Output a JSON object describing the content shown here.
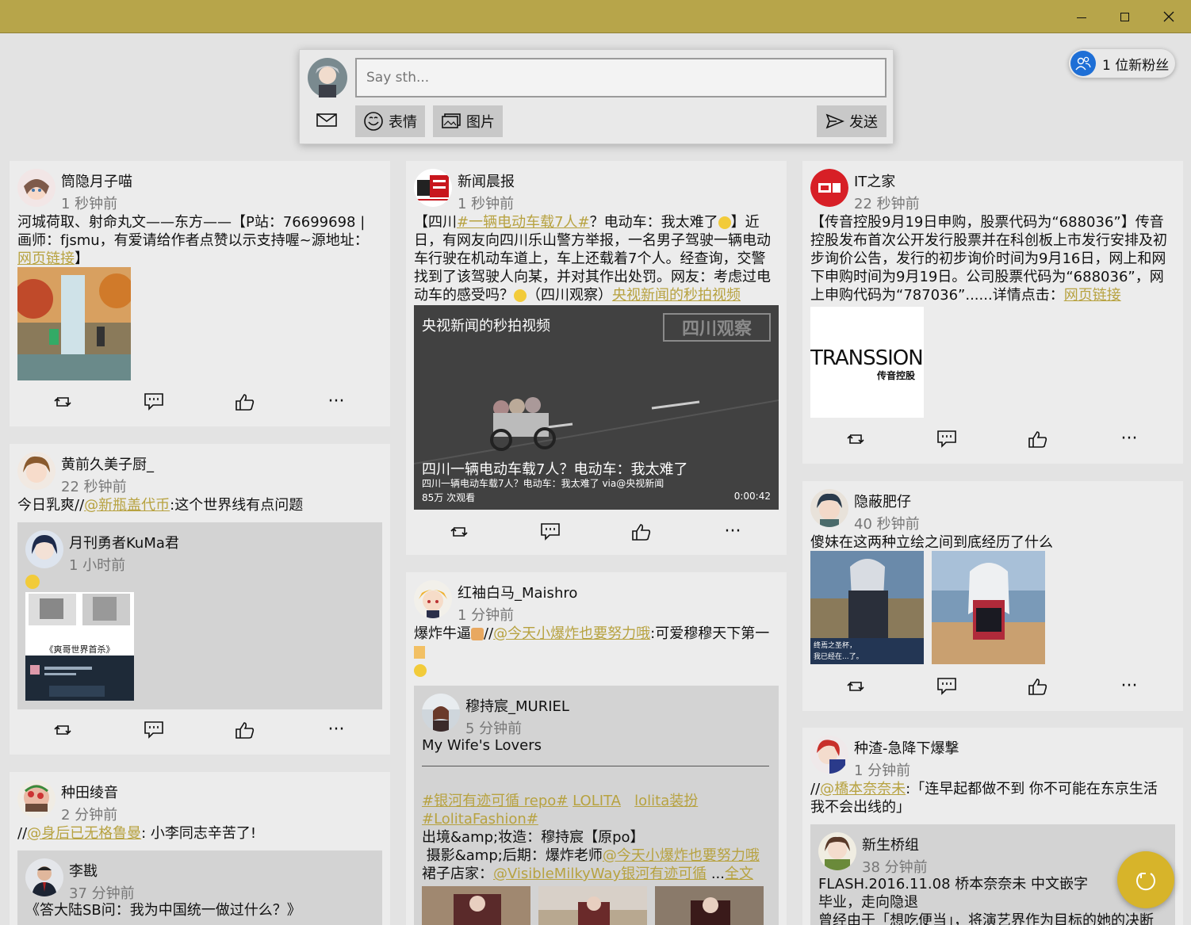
{
  "window": {
    "minimize": "",
    "maximize": "",
    "close": ""
  },
  "composer": {
    "placeholder": "Say sth...",
    "emoji_label": "表情",
    "image_label": "图片",
    "send_label": "发送"
  },
  "fans_badge": "1 位新粉丝",
  "colors": {
    "titlebar": "#b7a54a",
    "accent": "#b7a240",
    "loader": "#d7b42a",
    "fans_icon": "#1e6fd6"
  },
  "posts": {
    "p1": {
      "name": "筒隐月子喵",
      "time": "1 秒钟前",
      "text_a": "河城荷取、射命丸文——东方——【P站：76699698 | 画师：fjsmu，有爱请给作者点赞以示支持喔~源地址：",
      "link": "网页链接",
      "text_b": "】"
    },
    "p2": {
      "name": "黄前久美子厨_",
      "time": "22 秒钟前",
      "text_a": "今日乳爽//",
      "link": "@新瓶盖代币",
      "text_b": ":这个世界线有点问题",
      "quote": {
        "name": "月刊勇者KuMa君",
        "time": "1 小时前",
        "thumb_caption": "《爽哥世界首杀》"
      }
    },
    "p3": {
      "name": "种田绫音",
      "time": "2 分钟前",
      "text_a": "//",
      "link": "@身后已无格鲁曼",
      "text_b": ": 小李同志辛苦了!",
      "quote": {
        "name": "李戡",
        "time": "37 分钟前",
        "text": "《答大陆SB问：我为中国统一做过什么？》"
      }
    },
    "p4": {
      "name": "新闻晨报",
      "time": "1 秒钟前",
      "text_a": "【四川",
      "link": "#一辆电动车载7人#",
      "text_b": "？电动车：我太难了",
      "text_c": "】近日，有网友向四川乐山警方举报，一名男子驾驶一辆电动车行驶在机动车道上，车上还载着7个人。经查询，交警找到了该驾驶人向某，并对其作出处罚。网友：考虑过电动车的感受吗？",
      "text_d": "（四川观察）",
      "link2": "央视新闻的秒拍视频",
      "video": {
        "title": "央视新闻的秒拍视频",
        "watermark": "四川观察",
        "caption": "四川一辆电动车载7人？电动车：我太难了",
        "sub": "四川一辆电动车载7人？电动车：我太难了 via@央视新闻",
        "views": "85万 次观看",
        "duration": "0:00:42"
      }
    },
    "p5": {
      "name": "红袖白马_Maishro",
      "time": "1 分钟前",
      "text_a": "爆炸牛逼",
      "text_sep": "//",
      "link": "@今天小爆炸也要努力哦",
      "text_b": ":可爱穆穆天下第一",
      "quote": {
        "name": "穆持宸_MURIEL",
        "time": "5 分钟前",
        "line1": "My Wife's Lovers",
        "tag1": "#银河有迹可循 repo#",
        "tag2": "LOLITA",
        "tag3": "lolita装扮",
        "tag4": "#LolitaFashion#",
        "line_a": "出境&amp;妆造：穆持宸【原po】",
        "line_b": "摄影&amp;后期：爆炸老师",
        "link_b": "@今天小爆炸也要努力哦",
        "line_c": "裙子店家：",
        "link_c": "@VisibleMilkyWay银河有迹可循",
        "more_sep": " ...",
        "more": "全文"
      }
    },
    "p6": {
      "name": "IT之家",
      "time": "22 秒钟前",
      "text_a": "【传音控股9月19日申购，股票代码为“688036”】传音控股发布首次公开发行股票并在科创板上市发行安排及初步询价公告，发行的初步询价时间为9月16日，网上和网下申购时间为9月19日。公司股票代码为“688036”，网上申购代码为“787036”......详情点击：",
      "link": "网页链接",
      "image_text": "TRANSSION",
      "image_sub": "传音控股"
    },
    "p7": {
      "name": "隐蔽肥仔",
      "time": "40 秒钟前",
      "text": "傻妹在这两种立绘之间到底经历了什么",
      "img_text1": "终焉之圣杯，",
      "img_text2": "我已经在...了。"
    },
    "p8": {
      "name": "种渣-急降下爆撃",
      "time": "1 分钟前",
      "text_a": "//",
      "link": "@橋本奈奈未",
      "text_b": ":「连早起都做不到 你不可能在东京生活 我不会出线的」",
      "quote": {
        "name": "新生桥组",
        "time": "38 分钟前",
        "line1": "FLASH.2016.11.08 桥本奈奈未 中文嵌字",
        "line2": "毕业，走向隐退",
        "line3": "曾经由于「想吃便当」，将演艺界作为目标的她的决断"
      }
    }
  }
}
